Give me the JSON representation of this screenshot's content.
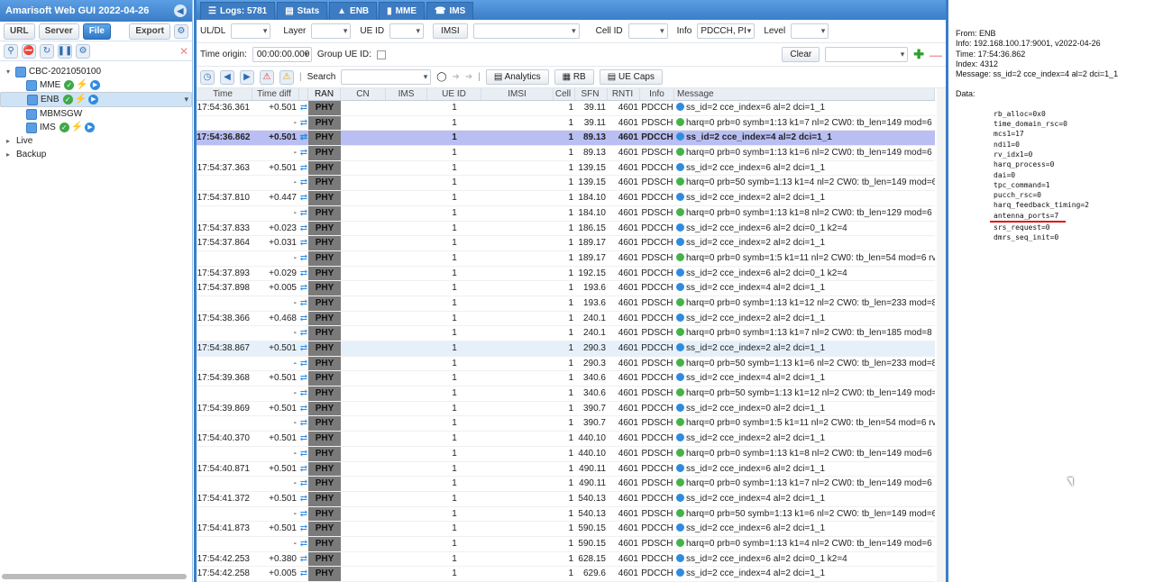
{
  "app_title": "Amarisoft Web GUI 2022-04-26",
  "left": {
    "buttons": [
      "URL",
      "Server",
      "File",
      "Export"
    ],
    "active_button": "File",
    "tree": [
      {
        "label": "CBC-2021050100",
        "level": 0,
        "expanded": true
      },
      {
        "label": "MME",
        "level": 1,
        "status": true
      },
      {
        "label": "ENB",
        "level": 1,
        "status": true,
        "selected": true
      },
      {
        "label": "MBMSGW",
        "level": 1,
        "status": false
      },
      {
        "label": "IMS",
        "level": 1,
        "status": true
      },
      {
        "label": "Live",
        "level": 0,
        "expanded": false
      },
      {
        "label": "Backup",
        "level": 0,
        "expanded": false
      }
    ]
  },
  "tabs": [
    {
      "label": "Logs: 5781",
      "icon": "logs-icon"
    },
    {
      "label": "Stats",
      "icon": "chart-icon"
    },
    {
      "label": "ENB",
      "icon": "antenna-icon"
    },
    {
      "label": "MME",
      "icon": "server-icon"
    },
    {
      "label": "IMS",
      "icon": "phone-icon"
    }
  ],
  "toolbar1": {
    "uldl_label": "UL/DL",
    "layer_label": "Layer",
    "ueid_label": "UE ID",
    "imsi_btn": "IMSI",
    "cellid_label": "Cell ID",
    "info_label": "Info",
    "info_value": "PDCCH, PI",
    "level_label": "Level"
  },
  "toolbar2": {
    "time_origin_label": "Time origin:",
    "time_origin_value": "00:00:00.000",
    "group_ueid_label": "Group UE ID:",
    "clear_label": "Clear"
  },
  "toolbar3": {
    "search_label": "Search",
    "analytics_label": "Analytics",
    "rb_label": "RB",
    "uecaps_label": "UE Caps"
  },
  "columns": [
    "Time",
    "Time diff",
    "RAN",
    "CN",
    "IMS",
    "UE ID",
    "IMSI",
    "Cell",
    "SFN",
    "RNTI",
    "Info",
    "Message"
  ],
  "rows": [
    {
      "time": "17:54:36.361",
      "diff": "+0.501",
      "ran": "PHY",
      "ue": "1",
      "cell": "1",
      "sfn": "39.11",
      "rnti": "4601",
      "info": "PDCCH",
      "msg": "ss_id=2 cce_index=6 al=2 dci=1_1",
      "kind": "i"
    },
    {
      "time": "",
      "diff": "-",
      "ran": "PHY",
      "ue": "1",
      "cell": "1",
      "sfn": "39.11",
      "rnti": "4601",
      "info": "PDSCH",
      "msg": "harq=0 prb=0 symb=1:13 k1=7 nl=2 CW0: tb_len=149 mod=6 rv_i",
      "kind": "h"
    },
    {
      "time": "17:54:36.862",
      "diff": "+0.501",
      "ran": "PHY",
      "ue": "1",
      "cell": "1",
      "sfn": "89.13",
      "rnti": "4601",
      "info": "PDCCH",
      "msg": "ss_id=2 cce_index=4 al=2 dci=1_1",
      "kind": "i",
      "hl": true
    },
    {
      "time": "",
      "diff": "-",
      "ran": "PHY",
      "ue": "1",
      "cell": "1",
      "sfn": "89.13",
      "rnti": "4601",
      "info": "PDSCH",
      "msg": "harq=0 prb=0 symb=1:13 k1=6 nl=2 CW0: tb_len=149 mod=6 rv_i",
      "kind": "h"
    },
    {
      "time": "17:54:37.363",
      "diff": "+0.501",
      "ran": "PHY",
      "ue": "1",
      "cell": "1",
      "sfn": "139.15",
      "rnti": "4601",
      "info": "PDCCH",
      "msg": "ss_id=2 cce_index=6 al=2 dci=1_1",
      "kind": "i"
    },
    {
      "time": "",
      "diff": "-",
      "ran": "PHY",
      "ue": "1",
      "cell": "1",
      "sfn": "139.15",
      "rnti": "4601",
      "info": "PDSCH",
      "msg": "harq=0 prb=50 symb=1:13 k1=4 nl=2 CW0: tb_len=149 mod=6 rv_",
      "kind": "h"
    },
    {
      "time": "17:54:37.810",
      "diff": "+0.447",
      "ran": "PHY",
      "ue": "1",
      "cell": "1",
      "sfn": "184.10",
      "rnti": "4601",
      "info": "PDCCH",
      "msg": "ss_id=2 cce_index=2 al=2 dci=1_1",
      "kind": "i"
    },
    {
      "time": "",
      "diff": "-",
      "ran": "PHY",
      "ue": "1",
      "cell": "1",
      "sfn": "184.10",
      "rnti": "4601",
      "info": "PDSCH",
      "msg": "harq=0 prb=0 symb=1:13 k1=8 nl=2 CW0: tb_len=129 mod=6 rv_i",
      "kind": "h"
    },
    {
      "time": "17:54:37.833",
      "diff": "+0.023",
      "ran": "PHY",
      "ue": "1",
      "cell": "1",
      "sfn": "186.15",
      "rnti": "4601",
      "info": "PDCCH",
      "msg": "ss_id=2 cce_index=6 al=2 dci=0_1 k2=4",
      "kind": "i"
    },
    {
      "time": "17:54:37.864",
      "diff": "+0.031",
      "ran": "PHY",
      "ue": "1",
      "cell": "1",
      "sfn": "189.17",
      "rnti": "4601",
      "info": "PDCCH",
      "msg": "ss_id=2 cce_index=2 al=2 dci=1_1",
      "kind": "i"
    },
    {
      "time": "",
      "diff": "-",
      "ran": "PHY",
      "ue": "1",
      "cell": "1",
      "sfn": "189.17",
      "rnti": "4601",
      "info": "PDSCH",
      "msg": "harq=0 prb=0 symb=1:5 k1=11 nl=2 CW0: tb_len=54 mod=6 rv_idx",
      "kind": "h"
    },
    {
      "time": "17:54:37.893",
      "diff": "+0.029",
      "ran": "PHY",
      "ue": "1",
      "cell": "1",
      "sfn": "192.15",
      "rnti": "4601",
      "info": "PDCCH",
      "msg": "ss_id=2 cce_index=6 al=2 dci=0_1 k2=4",
      "kind": "i"
    },
    {
      "time": "17:54:37.898",
      "diff": "+0.005",
      "ran": "PHY",
      "ue": "1",
      "cell": "1",
      "sfn": "193.6",
      "rnti": "4601",
      "info": "PDCCH",
      "msg": "ss_id=2 cce_index=4 al=2 dci=1_1",
      "kind": "i"
    },
    {
      "time": "",
      "diff": "-",
      "ran": "PHY",
      "ue": "1",
      "cell": "1",
      "sfn": "193.6",
      "rnti": "4601",
      "info": "PDSCH",
      "msg": "harq=0 prb=0 symb=1:13 k1=12 nl=2 CW0: tb_len=233 mod=8 rv_i",
      "kind": "h"
    },
    {
      "time": "17:54:38.366",
      "diff": "+0.468",
      "ran": "PHY",
      "ue": "1",
      "cell": "1",
      "sfn": "240.1",
      "rnti": "4601",
      "info": "PDCCH",
      "msg": "ss_id=2 cce_index=2 al=2 dci=1_1",
      "kind": "i"
    },
    {
      "time": "",
      "diff": "-",
      "ran": "PHY",
      "ue": "1",
      "cell": "1",
      "sfn": "240.1",
      "rnti": "4601",
      "info": "PDSCH",
      "msg": "harq=0 prb=0 symb=1:13 k1=7 nl=2 CW0: tb_len=185 mod=8 rv_i",
      "kind": "h"
    },
    {
      "time": "17:54:38.867",
      "diff": "+0.501",
      "ran": "PHY",
      "ue": "1",
      "cell": "1",
      "sfn": "290.3",
      "rnti": "4601",
      "info": "PDCCH",
      "msg": "ss_id=2 cce_index=2 al=2 dci=1_1",
      "kind": "i",
      "alt": true
    },
    {
      "time": "",
      "diff": "-",
      "ran": "PHY",
      "ue": "1",
      "cell": "1",
      "sfn": "290.3",
      "rnti": "4601",
      "info": "PDSCH",
      "msg": "harq=0 prb=50 symb=1:13 k1=6 nl=2 CW0: tb_len=233 mod=8 rv_",
      "kind": "h"
    },
    {
      "time": "17:54:39.368",
      "diff": "+0.501",
      "ran": "PHY",
      "ue": "1",
      "cell": "1",
      "sfn": "340.6",
      "rnti": "4601",
      "info": "PDCCH",
      "msg": "ss_id=2 cce_index=4 al=2 dci=1_1",
      "kind": "i"
    },
    {
      "time": "",
      "diff": "-",
      "ran": "PHY",
      "ue": "1",
      "cell": "1",
      "sfn": "340.6",
      "rnti": "4601",
      "info": "PDSCH",
      "msg": "harq=0 prb=50 symb=1:13 k1=12 nl=2 CW0: tb_len=149 mod=6 rv",
      "kind": "h"
    },
    {
      "time": "17:54:39.869",
      "diff": "+0.501",
      "ran": "PHY",
      "ue": "1",
      "cell": "1",
      "sfn": "390.7",
      "rnti": "4601",
      "info": "PDCCH",
      "msg": "ss_id=2 cce_index=0 al=2 dci=1_1",
      "kind": "i"
    },
    {
      "time": "",
      "diff": "-",
      "ran": "PHY",
      "ue": "1",
      "cell": "1",
      "sfn": "390.7",
      "rnti": "4601",
      "info": "PDSCH",
      "msg": "harq=0 prb=0 symb=1:5 k1=11 nl=2 CW0: tb_len=54 mod=6 rv_idx",
      "kind": "h"
    },
    {
      "time": "17:54:40.370",
      "diff": "+0.501",
      "ran": "PHY",
      "ue": "1",
      "cell": "1",
      "sfn": "440.10",
      "rnti": "4601",
      "info": "PDCCH",
      "msg": "ss_id=2 cce_index=2 al=2 dci=1_1",
      "kind": "i"
    },
    {
      "time": "",
      "diff": "-",
      "ran": "PHY",
      "ue": "1",
      "cell": "1",
      "sfn": "440.10",
      "rnti": "4601",
      "info": "PDSCH",
      "msg": "harq=0 prb=0 symb=1:13 k1=8 nl=2 CW0: tb_len=149 mod=6 rv_i",
      "kind": "h"
    },
    {
      "time": "17:54:40.871",
      "diff": "+0.501",
      "ran": "PHY",
      "ue": "1",
      "cell": "1",
      "sfn": "490.11",
      "rnti": "4601",
      "info": "PDCCH",
      "msg": "ss_id=2 cce_index=6 al=2 dci=1_1",
      "kind": "i"
    },
    {
      "time": "",
      "diff": "-",
      "ran": "PHY",
      "ue": "1",
      "cell": "1",
      "sfn": "490.11",
      "rnti": "4601",
      "info": "PDSCH",
      "msg": "harq=0 prb=0 symb=1:13 k1=7 nl=2 CW0: tb_len=149 mod=6 rv_i",
      "kind": "h"
    },
    {
      "time": "17:54:41.372",
      "diff": "+0.501",
      "ran": "PHY",
      "ue": "1",
      "cell": "1",
      "sfn": "540.13",
      "rnti": "4601",
      "info": "PDCCH",
      "msg": "ss_id=2 cce_index=4 al=2 dci=1_1",
      "kind": "i"
    },
    {
      "time": "",
      "diff": "-",
      "ran": "PHY",
      "ue": "1",
      "cell": "1",
      "sfn": "540.13",
      "rnti": "4601",
      "info": "PDSCH",
      "msg": "harq=0 prb=50 symb=1:13 k1=6 nl=2 CW0: tb_len=149 mod=6 rv_",
      "kind": "h"
    },
    {
      "time": "17:54:41.873",
      "diff": "+0.501",
      "ran": "PHY",
      "ue": "1",
      "cell": "1",
      "sfn": "590.15",
      "rnti": "4601",
      "info": "PDCCH",
      "msg": "ss_id=2 cce_index=6 al=2 dci=1_1",
      "kind": "i"
    },
    {
      "time": "",
      "diff": "-",
      "ran": "PHY",
      "ue": "1",
      "cell": "1",
      "sfn": "590.15",
      "rnti": "4601",
      "info": "PDSCH",
      "msg": "harq=0 prb=0 symb=1:13 k1=4 nl=2 CW0: tb_len=149 mod=6 rv_i",
      "kind": "h"
    },
    {
      "time": "17:54:42.253",
      "diff": "+0.380",
      "ran": "PHY",
      "ue": "1",
      "cell": "1",
      "sfn": "628.15",
      "rnti": "4601",
      "info": "PDCCH",
      "msg": "ss_id=2 cce_index=6 al=2 dci=0_1 k2=4",
      "kind": "i"
    },
    {
      "time": "17:54:42.258",
      "diff": "+0.005",
      "ran": "PHY",
      "ue": "1",
      "cell": "1",
      "sfn": "629.6",
      "rnti": "4601",
      "info": "PDCCH",
      "msg": "ss_id=2 cce_index=4 al=2 dci=1_1",
      "kind": "i"
    }
  ],
  "detail": {
    "from": "From: ENB",
    "info": "Info: 192.168.100.17:9001, v2022-04-26",
    "time": "Time: 17:54:36.862",
    "index": "Index: 4312",
    "message": "Message: ss_id=2 cce_index=4 al=2 dci=1_1",
    "data_label": "Data:",
    "fields": [
      "rb_alloc=0x0",
      "time_domain_rsc=0",
      "mcs1=17",
      "ndi1=0",
      "rv_idx1=0",
      "harq_process=0",
      "dai=0",
      "tpc_command=1",
      "pucch_rsc=0",
      "harq_feedback_timing=2",
      "antenna_ports=7",
      "srs_request=0",
      "dmrs_seq_init=0"
    ]
  }
}
